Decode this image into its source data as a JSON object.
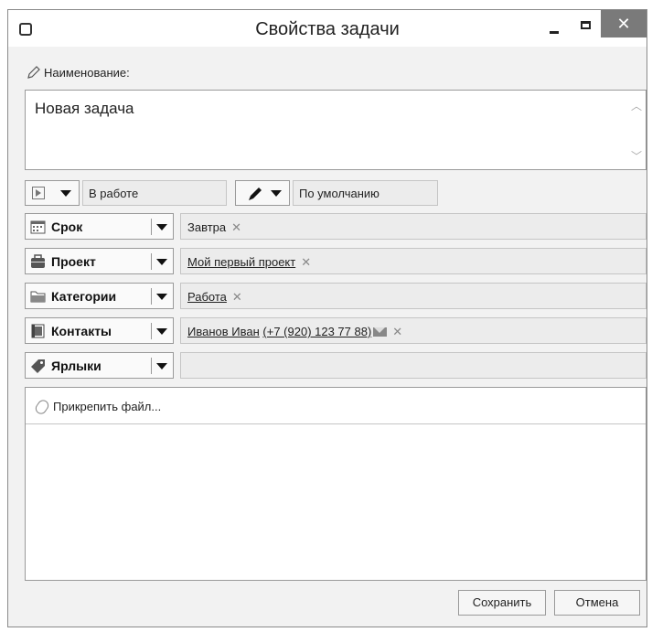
{
  "window": {
    "title": "Свойства задачи",
    "close_glyph": "✕"
  },
  "name": {
    "label": "Наименование:",
    "value": "Новая задача"
  },
  "status": {
    "value": "В работе"
  },
  "priority": {
    "value": "По умолчанию"
  },
  "fields": {
    "deadline": {
      "label": "Срок",
      "value": "Завтра"
    },
    "project": {
      "label": "Проект",
      "value": "Мой первый проект"
    },
    "categories": {
      "label": "Категории",
      "value": "Работа"
    },
    "contacts": {
      "label": "Контакты",
      "name": "Иванов Иван",
      "phone": "(+7 (920) 123 77 88)"
    },
    "tags": {
      "label": "Ярлыки",
      "value": ""
    }
  },
  "remove_glyph": "✕",
  "attach": {
    "label": "Прикрепить файл..."
  },
  "buttons": {
    "save": "Сохранить",
    "cancel": "Отмена"
  },
  "colors": {
    "close_button": "#7a7a7a",
    "field_bg": "#ececec"
  }
}
